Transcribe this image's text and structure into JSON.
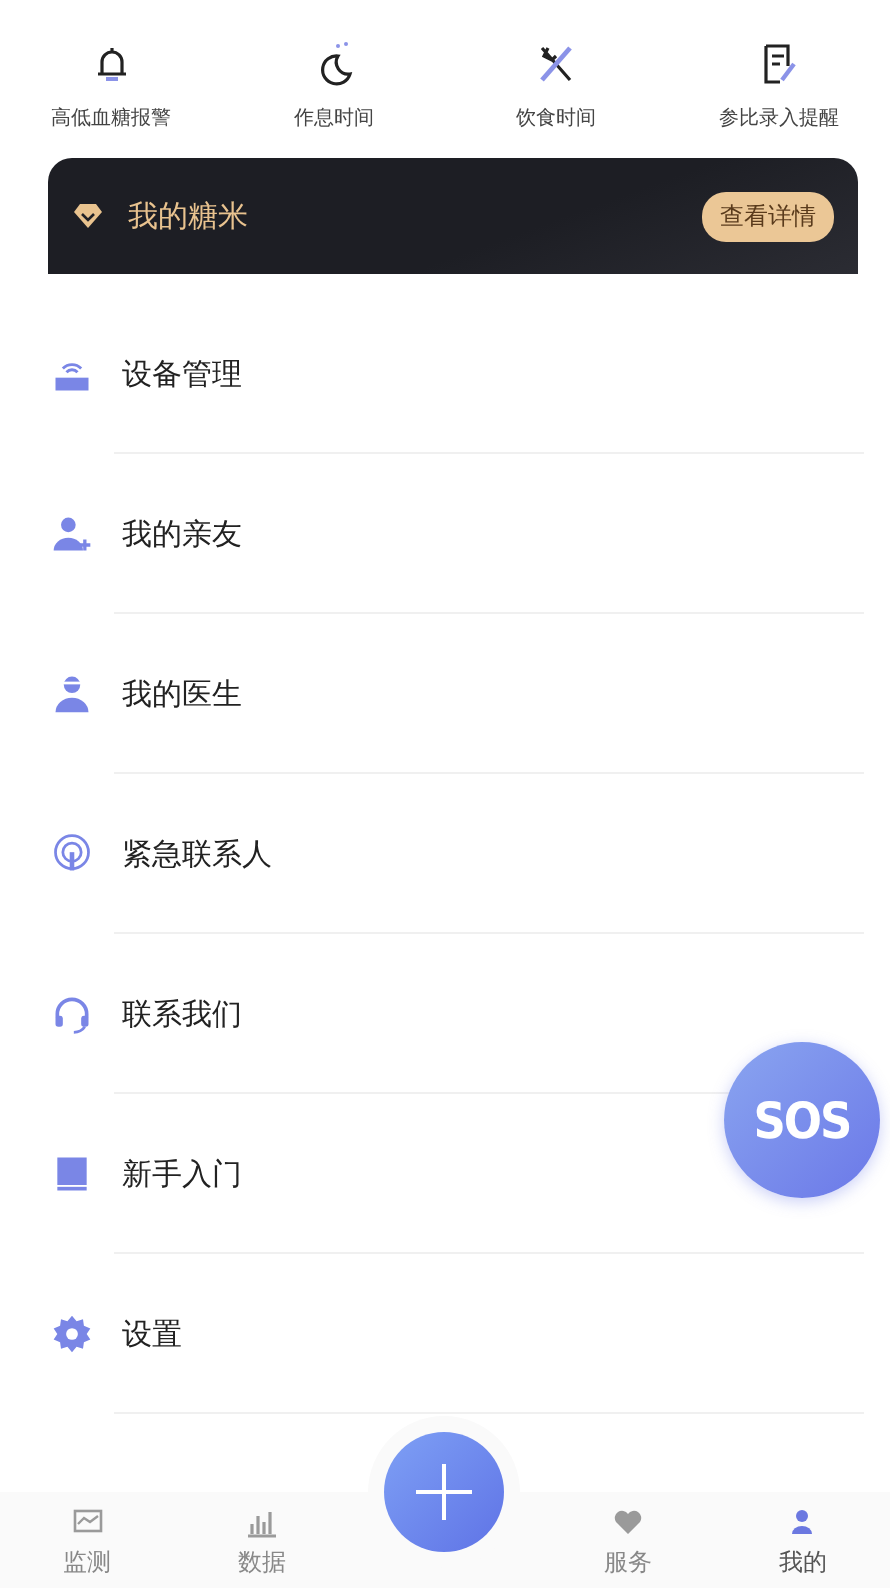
{
  "shortcuts": [
    {
      "label": "高低血糖报警"
    },
    {
      "label": "作息时间"
    },
    {
      "label": "饮食时间"
    },
    {
      "label": "参比录入提醒"
    }
  ],
  "membership": {
    "title": "我的糖米",
    "button": "查看详情"
  },
  "menu": [
    {
      "label": "设备管理"
    },
    {
      "label": "我的亲友"
    },
    {
      "label": "我的医生"
    },
    {
      "label": "紧急联系人"
    },
    {
      "label": "联系我们"
    },
    {
      "label": "新手入门"
    },
    {
      "label": "设置"
    }
  ],
  "sos_button": {
    "label": "SOS"
  },
  "tab_bar": [
    {
      "label": "监测",
      "selected": false
    },
    {
      "label": "数据",
      "selected": false
    },
    {
      "label": "服务",
      "selected": false
    },
    {
      "label": "我的",
      "selected": true
    }
  ]
}
